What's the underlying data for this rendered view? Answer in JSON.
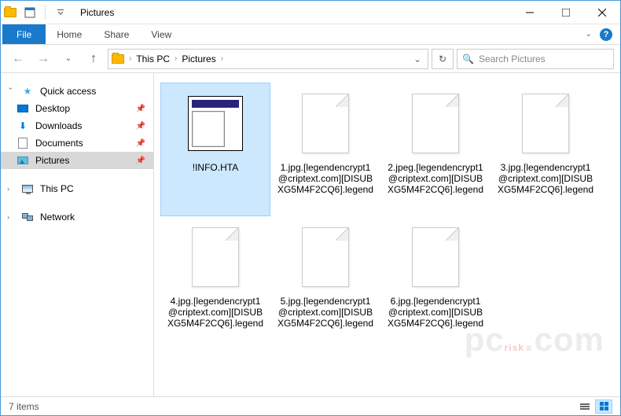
{
  "window": {
    "title": "Pictures"
  },
  "ribbon": {
    "file": "File",
    "tabs": [
      "Home",
      "Share",
      "View"
    ]
  },
  "breadcrumb": {
    "items": [
      "This PC",
      "Pictures"
    ]
  },
  "search": {
    "placeholder": "Search Pictures"
  },
  "nav": {
    "quick_access": {
      "label": "Quick access",
      "items": [
        {
          "label": "Desktop",
          "icon": "desktop",
          "pinned": true
        },
        {
          "label": "Downloads",
          "icon": "downloads",
          "pinned": true
        },
        {
          "label": "Documents",
          "icon": "documents",
          "pinned": true
        },
        {
          "label": "Pictures",
          "icon": "pictures",
          "pinned": true,
          "selected": true
        }
      ]
    },
    "this_pc": {
      "label": "This PC"
    },
    "network": {
      "label": "Network"
    }
  },
  "files": [
    {
      "name": "!INFO.HTA",
      "type": "hta",
      "selected": true
    },
    {
      "name": "1.jpg.[legendencrypt1@criptext.com][DISUBXG5M4F2CQ6].legend",
      "type": "blank"
    },
    {
      "name": "2.jpeg.[legendencrypt1@criptext.com][DISUBXG5M4F2CQ6].legend",
      "type": "blank"
    },
    {
      "name": "3.jpg.[legendencrypt1@criptext.com][DISUBXG5M4F2CQ6].legend",
      "type": "blank"
    },
    {
      "name": "4.jpg.[legendencrypt1@criptext.com][DISUBXG5M4F2CQ6].legend",
      "type": "blank"
    },
    {
      "name": "5.jpg.[legendencrypt1@criptext.com][DISUBXG5M4F2CQ6].legend",
      "type": "blank"
    },
    {
      "name": "6.jpg.[legendencrypt1@criptext.com][DISUBXG5M4F2CQ6].legend",
      "type": "blank"
    }
  ],
  "status": {
    "count_label": "7 items"
  }
}
